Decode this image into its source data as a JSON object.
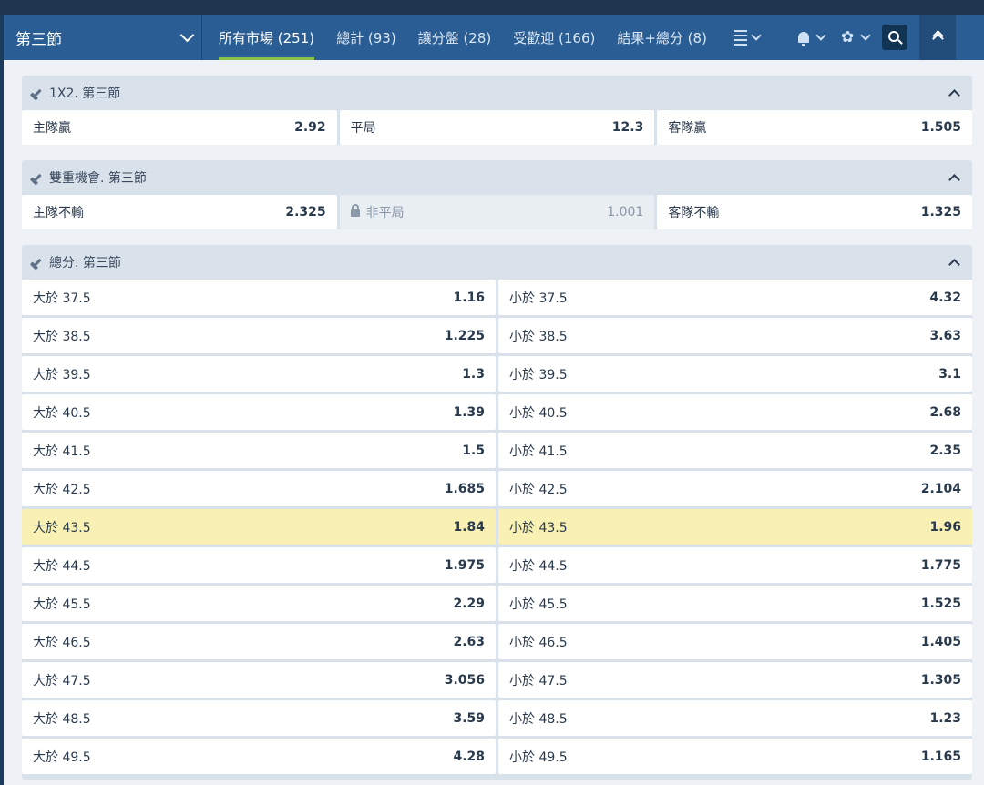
{
  "header": {
    "period_label": "第三節",
    "tabs": [
      {
        "label": "所有市場 (251)",
        "active": true
      },
      {
        "label": "總計 (93)",
        "active": false
      },
      {
        "label": "讓分盤 (28)",
        "active": false
      },
      {
        "label": "受歡迎 (166)",
        "active": false
      },
      {
        "label": "結果+總分 (8)",
        "active": false
      }
    ],
    "tools": [
      "list-icon",
      "bell-icon",
      "gear-icon",
      "search-icon",
      "collapse-up-icon"
    ]
  },
  "markets": [
    {
      "title": "1X2. 第三節",
      "outcomes": [
        {
          "label": "主隊贏",
          "odd": "2.92"
        },
        {
          "label": "平局",
          "odd": "12.3"
        },
        {
          "label": "客隊贏",
          "odd": "1.505"
        }
      ]
    },
    {
      "title": "雙重機會. 第三節",
      "outcomes": [
        {
          "label": "主隊不輸",
          "odd": "2.325"
        },
        {
          "label": "非平局",
          "odd": "1.001",
          "locked": true
        },
        {
          "label": "客隊不輸",
          "odd": "1.325"
        }
      ]
    },
    {
      "title": "總分. 第三節",
      "rows": [
        {
          "over": "大於 37.5",
          "over_odd": "1.16",
          "under": "小於 37.5",
          "under_odd": "4.32"
        },
        {
          "over": "大於 38.5",
          "over_odd": "1.225",
          "under": "小於 38.5",
          "under_odd": "3.63"
        },
        {
          "over": "大於 39.5",
          "over_odd": "1.3",
          "under": "小於 39.5",
          "under_odd": "3.1"
        },
        {
          "over": "大於 40.5",
          "over_odd": "1.39",
          "under": "小於 40.5",
          "under_odd": "2.68"
        },
        {
          "over": "大於 41.5",
          "over_odd": "1.5",
          "under": "小於 41.5",
          "under_odd": "2.35"
        },
        {
          "over": "大於 42.5",
          "over_odd": "1.685",
          "under": "小於 42.5",
          "under_odd": "2.104"
        },
        {
          "over": "大於 43.5",
          "over_odd": "1.84",
          "under": "小於 43.5",
          "under_odd": "1.96",
          "highlight": true
        },
        {
          "over": "大於 44.5",
          "over_odd": "1.975",
          "under": "小於 44.5",
          "under_odd": "1.775"
        },
        {
          "over": "大於 45.5",
          "over_odd": "2.29",
          "under": "小於 45.5",
          "under_odd": "1.525"
        },
        {
          "over": "大於 46.5",
          "over_odd": "2.63",
          "under": "小於 46.5",
          "under_odd": "1.405"
        },
        {
          "over": "大於 47.5",
          "over_odd": "3.056",
          "under": "小於 47.5",
          "under_odd": "1.305"
        },
        {
          "over": "大於 48.5",
          "over_odd": "3.59",
          "under": "小於 48.5",
          "under_odd": "1.23"
        },
        {
          "over": "大於 49.5",
          "over_odd": "4.28",
          "under": "小於 49.5",
          "under_odd": "1.165"
        }
      ]
    }
  ],
  "colors": {
    "navbar": "#2a5d93",
    "active_tab_underline": "#8bc34a",
    "highlight_row": "#f8f1b3",
    "market_header": "#d9e1ea"
  }
}
